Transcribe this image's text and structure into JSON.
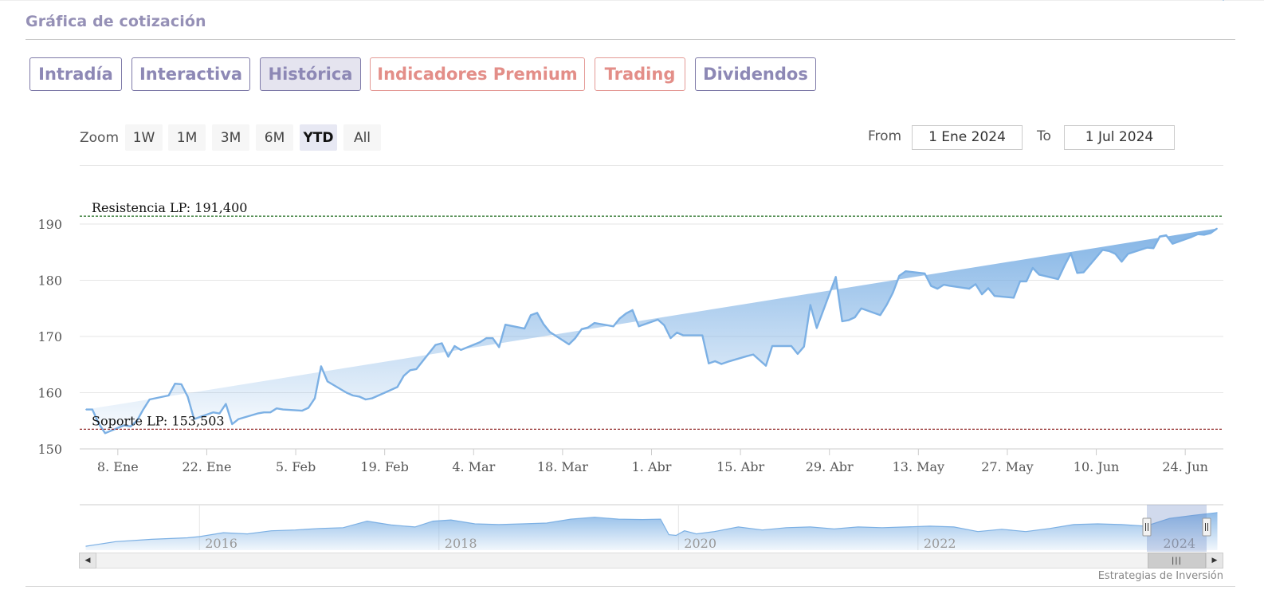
{
  "section": {
    "title": "Gráfica de cotización"
  },
  "tabs": [
    {
      "label": "Intradía",
      "state": "normal"
    },
    {
      "label": "Interactiva",
      "state": "normal"
    },
    {
      "label": "Histórica",
      "state": "active"
    },
    {
      "label": "Indicadores Premium",
      "state": "premium"
    },
    {
      "label": "Trading",
      "state": "premium"
    },
    {
      "label": "Dividendos",
      "state": "normal"
    }
  ],
  "zoom": {
    "label": "Zoom",
    "buttons": [
      "1W",
      "1M",
      "3M",
      "6M",
      "YTD",
      "All"
    ],
    "selected": "YTD"
  },
  "range": {
    "from_label": "From",
    "from_value": "1 Ene 2024",
    "to_label": "To",
    "to_value": "1 Jul 2024"
  },
  "credit": "Estrategias de Inversión",
  "colors": {
    "tab_border": "#7e7aa8",
    "tab_text": "#8d88b5",
    "premium_text": "#e38e88",
    "series_line": "#7cb0e4",
    "resistance_line": "#1f6b1f",
    "support_line": "#8b1a1a"
  },
  "chart_data": {
    "type": "area",
    "title": "",
    "xlabel": "",
    "ylabel": "",
    "ylim": [
      150,
      190
    ],
    "yticks": [
      150,
      160,
      170,
      180,
      190
    ],
    "grid": true,
    "xticks": [
      {
        "day": 7,
        "label": "8. Ene"
      },
      {
        "day": 21,
        "label": "22. Ene"
      },
      {
        "day": 35,
        "label": "5. Feb"
      },
      {
        "day": 49,
        "label": "19. Feb"
      },
      {
        "day": 63,
        "label": "4. Mar"
      },
      {
        "day": 77,
        "label": "18. Mar"
      },
      {
        "day": 91,
        "label": "1. Abr"
      },
      {
        "day": 105,
        "label": "15. Abr"
      },
      {
        "day": 119,
        "label": "29. Abr"
      },
      {
        "day": 133,
        "label": "13. May"
      },
      {
        "day": 147,
        "label": "27. May"
      },
      {
        "day": 161,
        "label": "10. Jun"
      },
      {
        "day": 175,
        "label": "24. Jun"
      }
    ],
    "series": [
      {
        "day": [
          2,
          3,
          4,
          5,
          8,
          9,
          10,
          11,
          12,
          15,
          16,
          17,
          18,
          19,
          22,
          23,
          24,
          25,
          26,
          29,
          30,
          31,
          32,
          33,
          36,
          37,
          38,
          39,
          40,
          43,
          44,
          45,
          46,
          47,
          50,
          51,
          52,
          53,
          54,
          57,
          58,
          59,
          60,
          61,
          64,
          65,
          66,
          67,
          68,
          71,
          72,
          73,
          74,
          75,
          78,
          79,
          80,
          81,
          82,
          85,
          86,
          87,
          88,
          89,
          92,
          93,
          94,
          95,
          96,
          99,
          100,
          101,
          102,
          103,
          106,
          107,
          108,
          109,
          110,
          113,
          114,
          115,
          116,
          117,
          120,
          121,
          122,
          123,
          124,
          127,
          128,
          129,
          130,
          131,
          134,
          135,
          136,
          137,
          138,
          141,
          142,
          143,
          144,
          145,
          148,
          149,
          150,
          151,
          152,
          155,
          156,
          157,
          158,
          159,
          162,
          163,
          164,
          165,
          166,
          169,
          170,
          171,
          172,
          173,
          176,
          177,
          178,
          179,
          180,
          181
        ],
        "values": [
          157.0,
          157.0,
          154.5,
          152.8,
          154.2,
          154.0,
          155.0,
          157.0,
          158.8,
          159.5,
          161.6,
          161.5,
          159.3,
          155.3,
          156.5,
          156.3,
          158.0,
          154.4,
          155.3,
          156.3,
          156.5,
          156.5,
          157.2,
          157.0,
          156.8,
          157.3,
          159.0,
          164.7,
          162.0,
          160.0,
          159.5,
          159.3,
          158.8,
          159.0,
          160.5,
          161.0,
          163.0,
          164.0,
          164.2,
          168.5,
          168.8,
          166.4,
          168.3,
          167.6,
          169.0,
          169.7,
          169.7,
          168.1,
          172.1,
          171.4,
          173.8,
          174.2,
          172.2,
          170.8,
          168.6,
          169.7,
          171.3,
          171.6,
          172.4,
          171.8,
          173.2,
          174.1,
          174.7,
          171.8,
          173.0,
          172.0,
          169.7,
          170.7,
          170.2,
          170.2,
          165.2,
          165.6,
          165.1,
          165.5,
          166.5,
          166.8,
          165.8,
          164.8,
          168.3,
          168.3,
          166.9,
          168.2,
          175.6,
          171.5,
          180.6,
          172.7,
          172.9,
          173.4,
          175.0,
          173.8,
          175.6,
          177.8,
          180.8,
          181.6,
          181.2,
          179.0,
          178.5,
          179.2,
          179.0,
          178.5,
          179.3,
          177.5,
          178.6,
          177.2,
          176.9,
          179.8,
          179.8,
          182.2,
          181.0,
          180.2,
          182.6,
          184.8,
          181.3,
          181.4,
          185.4,
          185.2,
          184.7,
          183.3,
          184.7,
          185.8,
          185.7,
          187.8,
          188.0,
          186.5,
          187.7,
          188.2,
          188.1,
          188.4,
          189.2
        ]
      }
    ],
    "annotations": [
      {
        "label": "Resistencia LP: 191,400",
        "value": 191.4
      },
      {
        "label": "Soporte LP: 153,503",
        "value": 153.503
      }
    ],
    "navigator": {
      "labels": [
        "2016",
        "2018",
        "2020",
        "2022",
        "2024"
      ],
      "year_start": 2015,
      "year_end": 2024.55,
      "x": [
        2015.05,
        2015.3,
        2015.6,
        2015.9,
        2016.0,
        2016.2,
        2016.4,
        2016.6,
        2016.8,
        2017.0,
        2017.2,
        2017.4,
        2017.6,
        2017.8,
        2017.95,
        2018.1,
        2018.3,
        2018.5,
        2018.7,
        2018.9,
        2019.1,
        2019.3,
        2019.5,
        2019.7,
        2019.85,
        2019.92,
        2019.98,
        2020.05,
        2020.15,
        2020.3,
        2020.5,
        2020.7,
        2020.9,
        2021.1,
        2021.3,
        2021.5,
        2021.7,
        2021.9,
        2022.1,
        2022.3,
        2022.5,
        2022.7,
        2022.9,
        2023.1,
        2023.3,
        2023.5,
        2023.7,
        2023.9,
        2024.1,
        2024.3,
        2024.5
      ],
      "values": [
        100,
        112,
        118,
        122,
        125,
        135,
        132,
        140,
        142,
        146,
        148,
        165,
        155,
        150,
        165,
        168,
        158,
        156,
        158,
        160,
        170,
        175,
        170,
        169,
        170,
        130,
        128,
        140,
        132,
        138,
        150,
        142,
        148,
        150,
        145,
        150,
        148,
        150,
        152,
        150,
        138,
        144,
        138,
        146,
        156,
        158,
        156,
        152,
        172,
        180,
        187
      ]
    }
  }
}
